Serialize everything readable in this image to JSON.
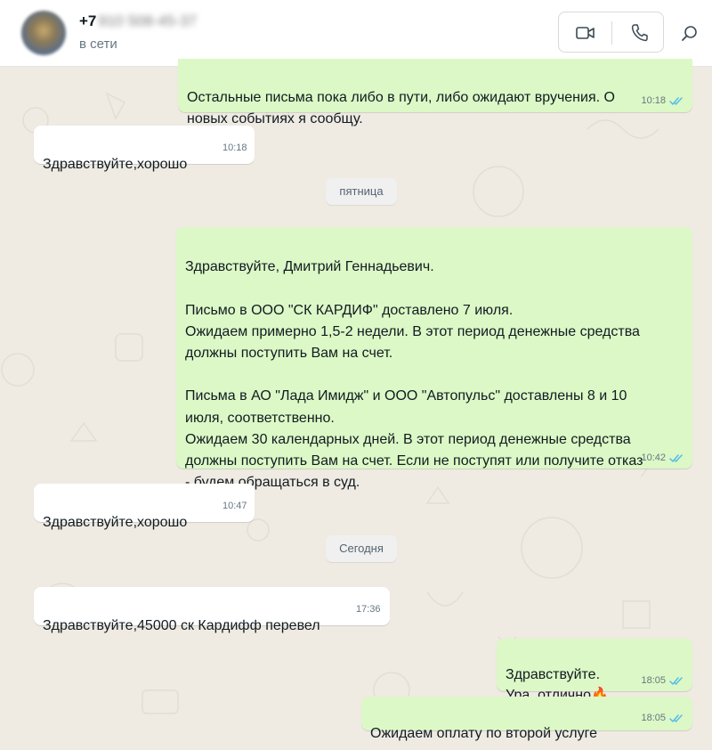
{
  "header": {
    "phone_prefix": "+7",
    "phone_hidden": "910 508-45-37",
    "status": "в сети"
  },
  "messages": [
    {
      "text": "Остальные письма пока либо в пути, либо ожидают вручения. О\nновых событиях я сообщу.",
      "time": "10:18",
      "direction": "out",
      "read": true
    },
    {
      "text": "Здравствуйте,хорошо",
      "time": "10:18",
      "direction": "in"
    },
    {
      "text": "Здравствуйте, Дмитрий Геннадьевич.\n\nПисьмо в ООО \"СК КАРДИФ\" доставлено 7 июля.\nОжидаем примерно 1,5-2 недели. В этот период денежные средства\nдолжны поступить Вам на счет.\n\nПисьма в АО \"Лада Имидж\" и ООО \"Автопульс\" доставлены 8 и 10\nиюля, соответственно.\nОжидаем 30 календарных дней. В этот период денежные средства\nдолжны поступить Вам на счет. Если не поступят или получите отказ\n- будем обращаться в суд.",
      "time": "10:42",
      "direction": "out",
      "read": true
    },
    {
      "text": "Здравствуйте,хорошо",
      "time": "10:47",
      "direction": "in"
    },
    {
      "text": "Здравствуйте,45000 ск Кардифф перевел",
      "time": "17:36",
      "direction": "in"
    },
    {
      "text": "Здравствуйте.\nУра, отлично🔥",
      "time": "18:05",
      "direction": "out",
      "read": true
    },
    {
      "text": "Ожидаем оплату по второй услуге",
      "time": "18:05",
      "direction": "out",
      "read": true
    }
  ],
  "day_separators": [
    "пятница",
    "Сегодня"
  ],
  "colors": {
    "incoming": "#ffffff",
    "outgoing": "#dcf8c6",
    "read_ticks": "#53bdeb",
    "background": "#efeae2"
  },
  "icons": [
    "video-call-icon",
    "voice-call-icon",
    "search-icon",
    "double-check-icon"
  ]
}
